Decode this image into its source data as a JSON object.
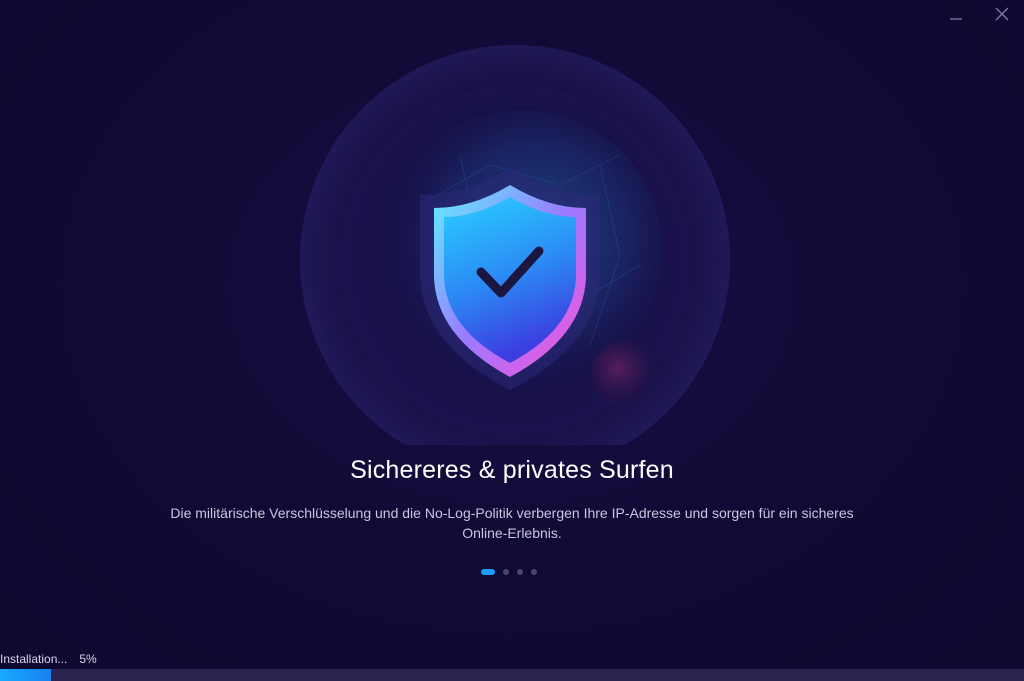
{
  "window": {
    "minimize_icon": "minimize-icon",
    "close_icon": "close-icon"
  },
  "hero": {
    "icon": "shield-check-icon",
    "colors": {
      "shield_gradient_start": "#2ad0ff",
      "shield_gradient_end": "#3b3fe0",
      "glow": "#ff4fd8",
      "check": "#1a1640"
    }
  },
  "slide": {
    "title": "Sichereres & privates Surfen",
    "description_line1": "Die militärische Verschlüsselung und die No-Log-Politik verbergen Ihre IP-Adresse und sorgen für ein sicheres",
    "description_line2": "Online-Erlebnis."
  },
  "carousel": {
    "total": 4,
    "active_index": 0
  },
  "install": {
    "status_label": "Installation...",
    "percent_label": "5%",
    "progress": 0.05
  },
  "colors": {
    "background": "#10082e",
    "accent": "#1e9bff",
    "progress_track": "#2a2550"
  }
}
